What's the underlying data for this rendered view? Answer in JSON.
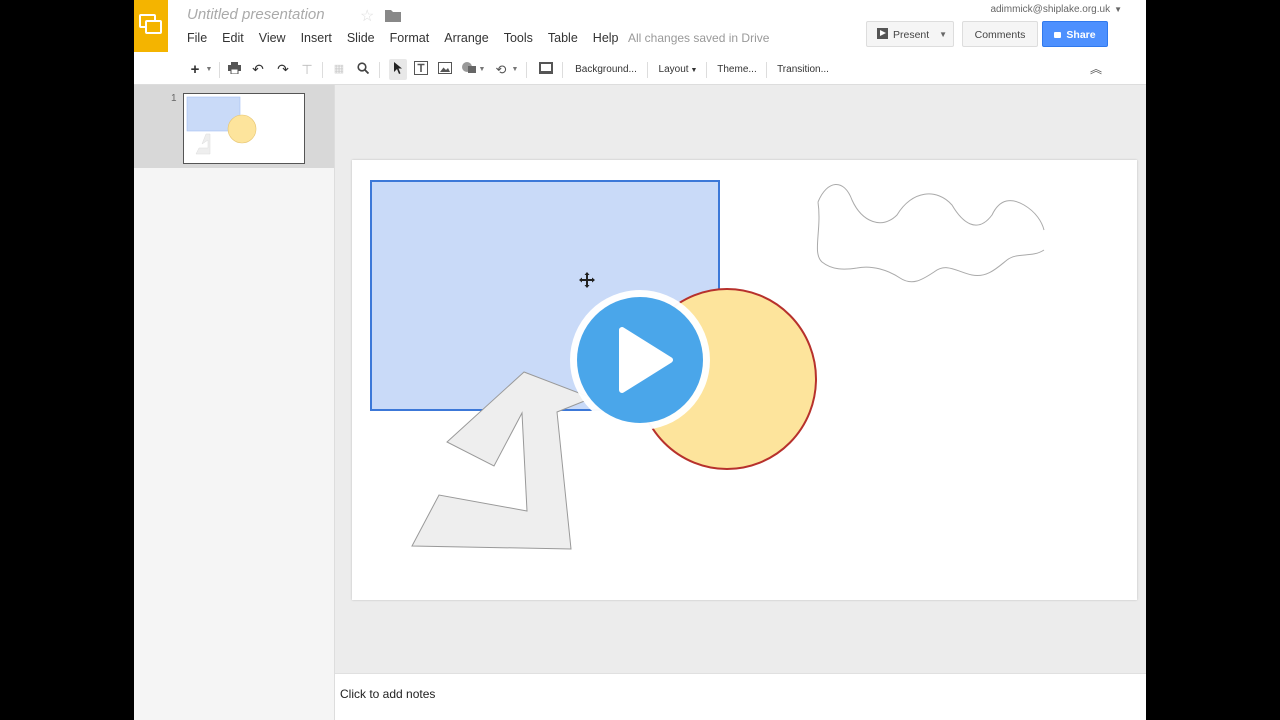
{
  "app": {
    "title": "Untitled presentation",
    "save_status": "All changes saved in Drive",
    "account": "adimmick@shiplake.org.uk",
    "brand_color": "#f4b400"
  },
  "menu": [
    "File",
    "Edit",
    "View",
    "Insert",
    "Slide",
    "Format",
    "Arrange",
    "Tools",
    "Table",
    "Help"
  ],
  "buttons": {
    "present": "Present",
    "comments": "Comments",
    "share": "Share",
    "share_color": "#4d90fe"
  },
  "toolbar": {
    "background": "Background...",
    "layout": "Layout",
    "theme": "Theme...",
    "transition": "Transition..."
  },
  "filmstrip": {
    "slides": [
      {
        "number": "1"
      }
    ]
  },
  "notes": {
    "placeholder": "Click to add notes"
  },
  "slide": {
    "shapes": [
      {
        "kind": "rectangle",
        "fill": "#c9daf8",
        "stroke": "#3c78d8"
      },
      {
        "kind": "ellipse",
        "fill": "#fde49c",
        "stroke": "#b7312c"
      },
      {
        "kind": "freeform-polygon",
        "fill": "#eeeeee",
        "stroke": "#999999"
      },
      {
        "kind": "scribble-line",
        "stroke": "#aaaaaa"
      }
    ]
  },
  "overlay": {
    "icon": "play-icon",
    "color": "#4aa6ea"
  }
}
